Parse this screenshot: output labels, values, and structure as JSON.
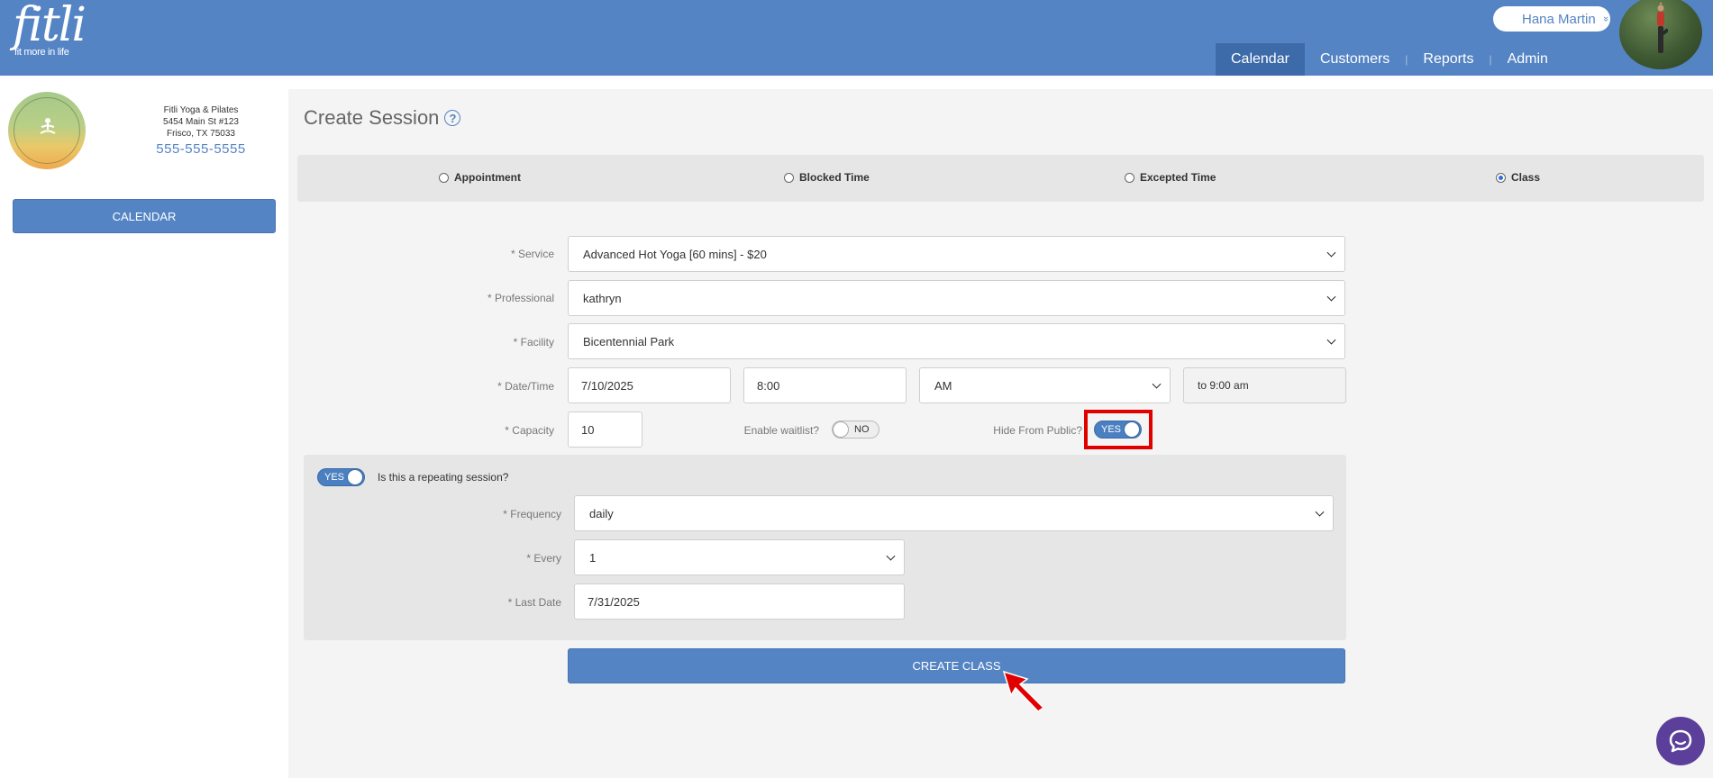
{
  "header": {
    "logo_word": "fitli",
    "logo_tagline": "fit more in life",
    "user_name": "Hana Martin",
    "user_chevron": "»",
    "nav": [
      {
        "label": "Calendar",
        "active": true
      },
      {
        "label": "Customers",
        "active": false
      },
      {
        "label": "Reports",
        "active": false
      },
      {
        "label": "Admin",
        "active": false
      }
    ],
    "nav_separator": "|",
    "brand_color": "#5484c4"
  },
  "sidebar": {
    "business_name": "Fitli Yoga & Pilates",
    "address_line1": "5454 Main St #123",
    "address_line2": "Frisco, TX 75033",
    "phone": "555-555-5555",
    "logo_text": "FITLI YOGA & PILATES",
    "calendar_button": "CALENDAR"
  },
  "page": {
    "title": "Create Session",
    "help_icon": "?"
  },
  "session_types": [
    {
      "label": "Appointment",
      "checked": false
    },
    {
      "label": "Blocked Time",
      "checked": false
    },
    {
      "label": "Excepted Time",
      "checked": false
    },
    {
      "label": "Class",
      "checked": true
    }
  ],
  "form": {
    "service_label": "* Service",
    "service_value": "Advanced Hot Yoga [60 mins] - $20",
    "professional_label": "* Professional",
    "professional_value": "kathryn",
    "facility_label": "* Facility",
    "facility_value": "Bicentennial Park",
    "datetime_label": "* Date/Time",
    "date_value": "7/10/2025",
    "time_value": "8:00",
    "ampm_value": "AM",
    "end_time": "to 9:00 am",
    "capacity_label": "* Capacity",
    "capacity_value": "10",
    "waitlist_label": "Enable waitlist?",
    "waitlist_toggle": "NO",
    "hide_label": "Hide From Public?",
    "hide_toggle": "YES"
  },
  "repeat": {
    "toggle": "YES",
    "question": "Is this a repeating session?",
    "frequency_label": "* Frequency",
    "frequency_value": "daily",
    "every_label": "* Every",
    "every_value": "1",
    "last_date_label": "* Last Date",
    "last_date_value": "7/31/2025"
  },
  "actions": {
    "create_button": "CREATE CLASS"
  },
  "icons": {
    "help": "help-circle-icon",
    "chat": "chat-icon",
    "cursor": "arrow-cursor-icon"
  }
}
